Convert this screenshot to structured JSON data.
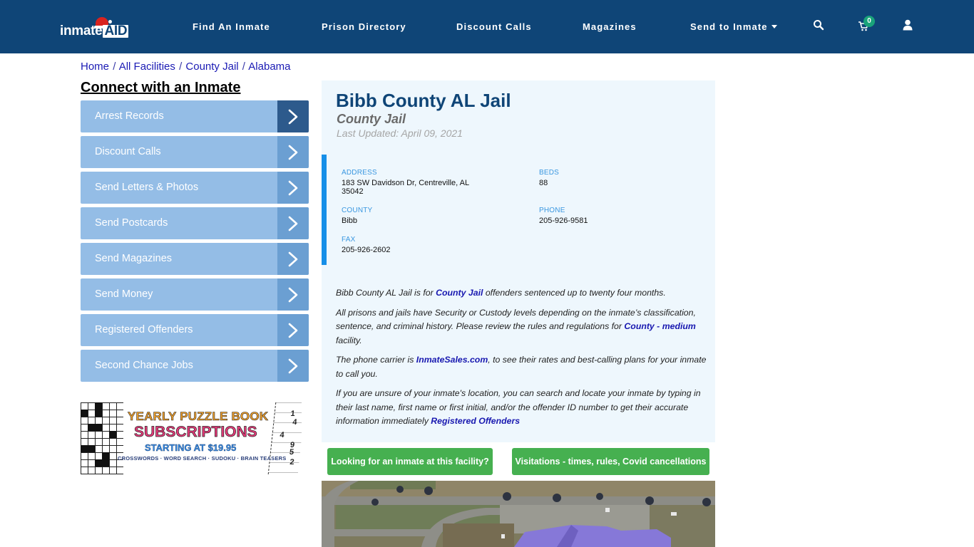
{
  "brand": {
    "logo_text": "inmate",
    "logo_badge": "AID"
  },
  "nav": {
    "items": [
      {
        "label": "Find An Inmate"
      },
      {
        "label": "Prison Directory"
      },
      {
        "label": "Discount Calls"
      },
      {
        "label": "Magazines"
      },
      {
        "label": "Send to Inmate",
        "has_dropdown": true
      }
    ],
    "icons": [
      "search-icon",
      "cart-icon",
      "user-icon"
    ],
    "cart_count": "0"
  },
  "breadcrumb": {
    "items": [
      "Home",
      "All Facilities",
      "County Jail",
      "Alabama"
    ],
    "separator": "/"
  },
  "sidebar": {
    "title": "Connect with an Inmate",
    "items": [
      {
        "label": "Arrest Records",
        "active": true
      },
      {
        "label": "Discount Calls"
      },
      {
        "label": "Send Letters & Photos"
      },
      {
        "label": "Send Postcards"
      },
      {
        "label": "Send Magazines"
      },
      {
        "label": "Send Money"
      },
      {
        "label": "Registered Offenders"
      },
      {
        "label": "Second Chance Jobs"
      }
    ],
    "ad": {
      "line1": "YEARLY PUZZLE BOOK",
      "line2": "SUBSCRIPTIONS",
      "line3": "STARTING AT $19.95",
      "line4": "CROSSWORDS · WORD SEARCH · SUDOKU · BRAIN TEASERS",
      "sudoku_numbers": [
        "1",
        "4",
        "4",
        "9",
        "5",
        "2"
      ]
    }
  },
  "facility": {
    "title": "Bibb County AL Jail",
    "type": "County Jail",
    "last_updated": "Last Updated: April 09, 2021",
    "info": {
      "address_label": "ADDRESS",
      "address_line1": "183 SW Davidson Dr, Centreville, AL",
      "address_line2": "35042",
      "beds_label": "BEDS",
      "beds": "88",
      "county_label": "COUNTY",
      "county": "Bibb",
      "phone_label": "PHONE",
      "phone": "205-926-9581",
      "fax_label": "FAX",
      "fax": "205-926-2602"
    },
    "description": {
      "p1_pre": "Bibb County AL Jail is for ",
      "p1_link": "County Jail",
      "p1_post": " offenders sentenced up to twenty four months.",
      "p2_pre": "All prisons and jails have Security or Custody levels depending on the inmate’s classification, sentence, and criminal history. Please review the rules and regulations for ",
      "p2_link": "County - medium",
      "p2_post": " facility.",
      "p3_pre": "The phone carrier is ",
      "p3_link": "InmateSales.com",
      "p3_post": ", to see their rates and best-calling plans for your inmate to call you.",
      "p4_pre": "If you are unsure of your inmate's location, you can search and locate your inmate by typing in their last name, first name or first initial, and/or the offender ID number to get their accurate information immediately ",
      "p4_link": "Registered Offenders"
    },
    "buttons": {
      "find_inmate": "Looking for an inmate at this facility?",
      "visitations": "Visitations - times, rules, Covid cancellations"
    }
  },
  "colors": {
    "navbar": "#0f4577",
    "sidebar_item": "#94bde6",
    "sidebar_arrow": "#6b9fd2",
    "sidebar_arrow_active": "#2d5a8c",
    "card_bg": "#eef7fd",
    "info_accent": "#168fe8",
    "green_button": "#46b050",
    "link": "#1818b0"
  }
}
